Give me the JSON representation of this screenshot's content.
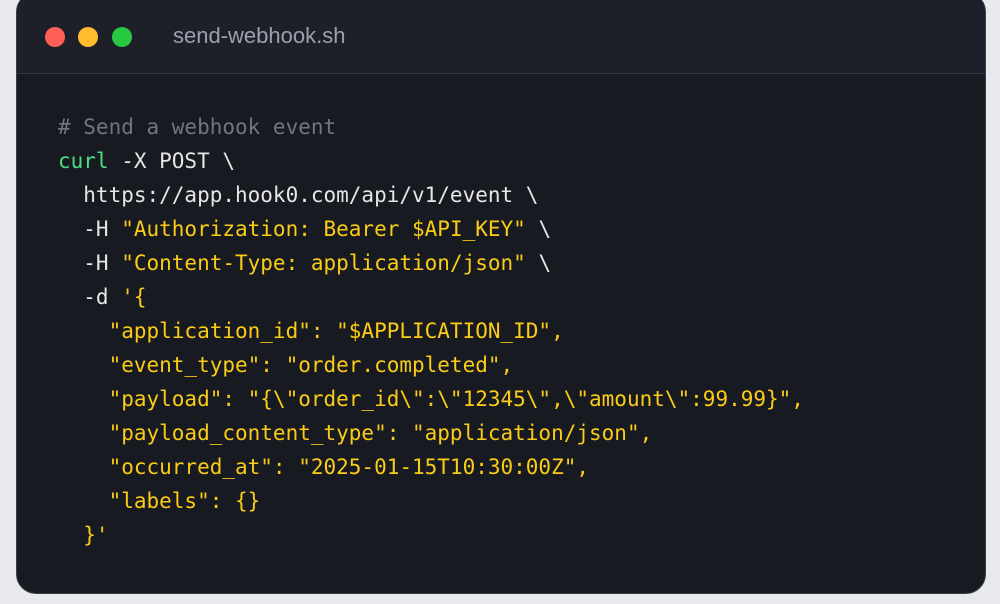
{
  "window": {
    "title": "send-webhook.sh",
    "controls": [
      "close",
      "minimize",
      "maximize"
    ]
  },
  "colors": {
    "comment": "#6f7585",
    "command": "#4ade80",
    "string": "#facc15",
    "plain": "#e6e6e6",
    "background": "#181a22",
    "titlebar": "#1e2029",
    "close": "#ff5f57",
    "minimize": "#febc2e",
    "maximize": "#28c840"
  },
  "code": {
    "lines": [
      [
        {
          "t": "# Send a webhook event",
          "k": "comment"
        }
      ],
      [
        {
          "t": "curl",
          "k": "cmd"
        },
        {
          "t": " -X POST \\",
          "k": "plain"
        }
      ],
      [
        {
          "t": "  https://app.hook0.com/api/v1/event \\",
          "k": "plain"
        }
      ],
      [
        {
          "t": "  -H ",
          "k": "plain"
        },
        {
          "t": "\"Authorization: Bearer $API_KEY\"",
          "k": "str"
        },
        {
          "t": " \\",
          "k": "plain"
        }
      ],
      [
        {
          "t": "  -H ",
          "k": "plain"
        },
        {
          "t": "\"Content-Type: application/json\"",
          "k": "str"
        },
        {
          "t": " \\",
          "k": "plain"
        }
      ],
      [
        {
          "t": "  -d ",
          "k": "plain"
        },
        {
          "t": "'{",
          "k": "str"
        }
      ],
      [
        {
          "t": "    \"application_id\": \"$APPLICATION_ID\",",
          "k": "str"
        }
      ],
      [
        {
          "t": "    \"event_type\": \"order.completed\",",
          "k": "str"
        }
      ],
      [
        {
          "t": "    \"payload\": \"{\\\"order_id\\\":\\\"12345\\\",\\\"amount\\\":99.99}\",",
          "k": "str"
        }
      ],
      [
        {
          "t": "    \"payload_content_type\": \"application/json\",",
          "k": "str"
        }
      ],
      [
        {
          "t": "    \"occurred_at\": \"2025-01-15T10:30:00Z\",",
          "k": "str"
        }
      ],
      [
        {
          "t": "    \"labels\": {}",
          "k": "str"
        }
      ],
      [
        {
          "t": "  }'",
          "k": "str"
        }
      ]
    ]
  }
}
